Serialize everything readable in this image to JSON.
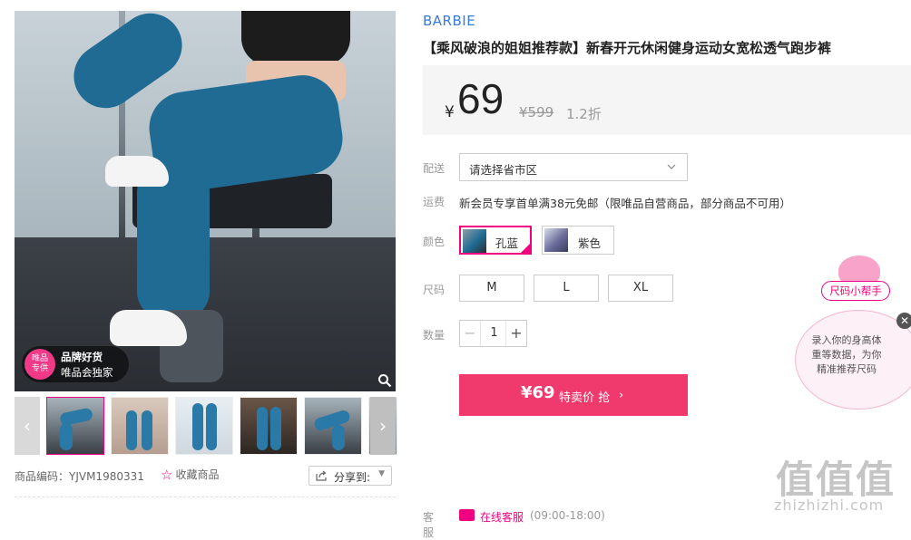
{
  "gallery": {
    "badge_line1": "品牌好货",
    "badge_line2": "唯品会独家",
    "badge_icon_line1": "唯品",
    "badge_icon_line2": "专供",
    "thumbs": [
      "thumb-1",
      "thumb-2",
      "thumb-3",
      "thumb-4",
      "thumb-5"
    ]
  },
  "meta": {
    "product_code": "商品编码：YJVM1980331",
    "favorite_label": "收藏商品",
    "share_label": "分享到:"
  },
  "product": {
    "brand": "BARBIE",
    "title": "【乘风破浪的姐姐推荐款】新春开元休闲健身运动女宽松透气跑步裤",
    "currency": "¥",
    "price": "69",
    "original_price": "¥599",
    "discount": "1.2折"
  },
  "delivery": {
    "label": "配送",
    "placeholder": "请选择省市区"
  },
  "shipping": {
    "label": "运费",
    "text": "新会员专享首单满38元免邮（限唯品自营商品，部分商品不可用）"
  },
  "color": {
    "label": "颜色",
    "options": [
      {
        "name": "孔蓝",
        "selected": true
      },
      {
        "name": "紫色",
        "selected": false
      }
    ]
  },
  "size": {
    "label": "尺码",
    "options": [
      "M",
      "L",
      "XL"
    ]
  },
  "quantity": {
    "label": "数量",
    "value": "1",
    "minus": "−",
    "plus": "+"
  },
  "buy": {
    "price": "¥69",
    "text": "特卖价 抢"
  },
  "service": {
    "label": "客服",
    "link": "在线客服",
    "hours": "(09:00-18:00)"
  },
  "size_helper": {
    "tag": "尺码小帮手",
    "line1": "录入你的身高体",
    "line2": "重等数据，为你",
    "line3": "精准推荐尺码"
  },
  "watermark": {
    "big": "值值值",
    "small": "zhizhizhi.com"
  },
  "colors": {
    "accent": "#f10180",
    "buy_button": "#f0396d",
    "brand_link": "#3a7ad9"
  }
}
